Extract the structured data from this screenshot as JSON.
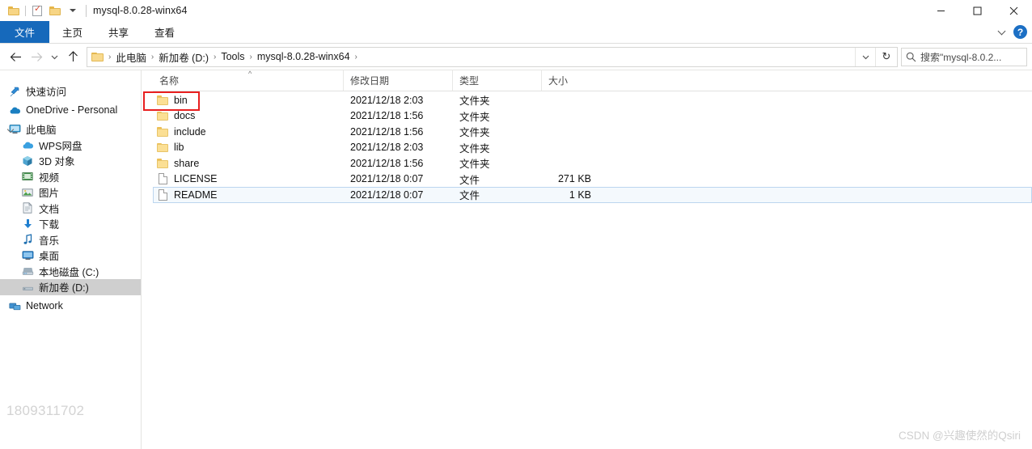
{
  "window": {
    "title": "mysql-8.0.28-winx64",
    "controls": {
      "minimize": "minimize-icon",
      "maximize": "maximize-icon",
      "close": "close-icon"
    }
  },
  "quick_access_toolbar": {
    "items": [
      {
        "name": "folder-icon",
        "icon": "folder-icon"
      },
      {
        "name": "properties-icon",
        "icon": "properties-checkbox-icon"
      },
      {
        "name": "new-folder-icon",
        "icon": "folder-icon"
      },
      {
        "name": "customize-caret",
        "icon": "caret-down-icon"
      }
    ]
  },
  "ribbon": {
    "tabs": [
      {
        "label": "文件",
        "active": true
      },
      {
        "label": "主页",
        "active": false
      },
      {
        "label": "共享",
        "active": false
      },
      {
        "label": "查看",
        "active": false
      }
    ],
    "expand_icon": "chevron-down-icon",
    "help_label": "?"
  },
  "address_bar": {
    "back_icon": "arrow-left-icon",
    "forward_icon": "arrow-right-icon",
    "recent_icon": "chevron-down-icon",
    "up_icon": "arrow-up-icon",
    "breadcrumbs": [
      "此电脑",
      "新加卷 (D:)",
      "Tools",
      "mysql-8.0.28-winx64"
    ],
    "separator": "›",
    "dropdown_icon": "chevron-down-icon",
    "refresh_icon": "refresh-icon"
  },
  "search": {
    "placeholder": "搜索\"mysql-8.0.2...",
    "icon": "search-icon"
  },
  "sidebar": {
    "items": [
      {
        "label": "快速访问",
        "icon": "pin-icon",
        "level": 0,
        "selected": false,
        "expandable": false,
        "group": true
      },
      {
        "label": "OneDrive - Personal",
        "icon": "cloud-icon",
        "level": 0,
        "selected": false,
        "expandable": false,
        "group": true
      },
      {
        "label": "此电脑",
        "icon": "monitor-icon",
        "level": 0,
        "selected": false,
        "expandable": true,
        "group": true
      },
      {
        "label": "WPS网盘",
        "icon": "cloud-blue-icon",
        "level": 1,
        "selected": false,
        "expandable": false,
        "group": false
      },
      {
        "label": "3D 对象",
        "icon": "cube-icon",
        "level": 1,
        "selected": false,
        "expandable": false,
        "group": false
      },
      {
        "label": "视频",
        "icon": "video-icon",
        "level": 1,
        "selected": false,
        "expandable": false,
        "group": false
      },
      {
        "label": "图片",
        "icon": "picture-icon",
        "level": 1,
        "selected": false,
        "expandable": false,
        "group": false
      },
      {
        "label": "文档",
        "icon": "document-icon",
        "level": 1,
        "selected": false,
        "expandable": false,
        "group": false
      },
      {
        "label": "下载",
        "icon": "download-icon",
        "level": 1,
        "selected": false,
        "expandable": false,
        "group": false
      },
      {
        "label": "音乐",
        "icon": "music-icon",
        "level": 1,
        "selected": false,
        "expandable": false,
        "group": false
      },
      {
        "label": "桌面",
        "icon": "desktop-icon",
        "level": 1,
        "selected": false,
        "expandable": false,
        "group": false
      },
      {
        "label": "本地磁盘 (C:)",
        "icon": "drive-icon",
        "level": 1,
        "selected": false,
        "expandable": false,
        "group": false
      },
      {
        "label": "新加卷 (D:)",
        "icon": "drive-icon",
        "level": 1,
        "selected": true,
        "expandable": false,
        "group": false
      },
      {
        "label": "Network",
        "icon": "network-icon",
        "level": 0,
        "selected": false,
        "expandable": false,
        "group": true
      }
    ]
  },
  "file_list": {
    "columns": [
      {
        "label": "名称",
        "sorted": "asc"
      },
      {
        "label": "修改日期",
        "sorted": ""
      },
      {
        "label": "类型",
        "sorted": ""
      },
      {
        "label": "大小",
        "sorted": ""
      }
    ],
    "sort_indicator": "^",
    "rows": [
      {
        "name": "bin",
        "date": "2021/12/18 2:03",
        "type": "文件夹",
        "size": "",
        "kind": "folder",
        "focused": false,
        "annotated": true
      },
      {
        "name": "docs",
        "date": "2021/12/18 1:56",
        "type": "文件夹",
        "size": "",
        "kind": "folder",
        "focused": false,
        "annotated": false
      },
      {
        "name": "include",
        "date": "2021/12/18 1:56",
        "type": "文件夹",
        "size": "",
        "kind": "folder",
        "focused": false,
        "annotated": false
      },
      {
        "name": "lib",
        "date": "2021/12/18 2:03",
        "type": "文件夹",
        "size": "",
        "kind": "folder",
        "focused": false,
        "annotated": false
      },
      {
        "name": "share",
        "date": "2021/12/18 1:56",
        "type": "文件夹",
        "size": "",
        "kind": "folder",
        "focused": false,
        "annotated": false
      },
      {
        "name": "LICENSE",
        "date": "2021/12/18 0:07",
        "type": "文件",
        "size": "271 KB",
        "kind": "file",
        "focused": false,
        "annotated": false
      },
      {
        "name": "README",
        "date": "2021/12/18 0:07",
        "type": "文件",
        "size": "1 KB",
        "kind": "file",
        "focused": true,
        "annotated": false
      }
    ]
  },
  "watermarks": {
    "left": "1809311702",
    "right": "CSDN @兴趣使然的Qsiri"
  },
  "colors": {
    "accent": "#1669bb",
    "annotation": "#e81f1f",
    "folder": "#fbdf94",
    "selection": "#cfcfcf"
  }
}
